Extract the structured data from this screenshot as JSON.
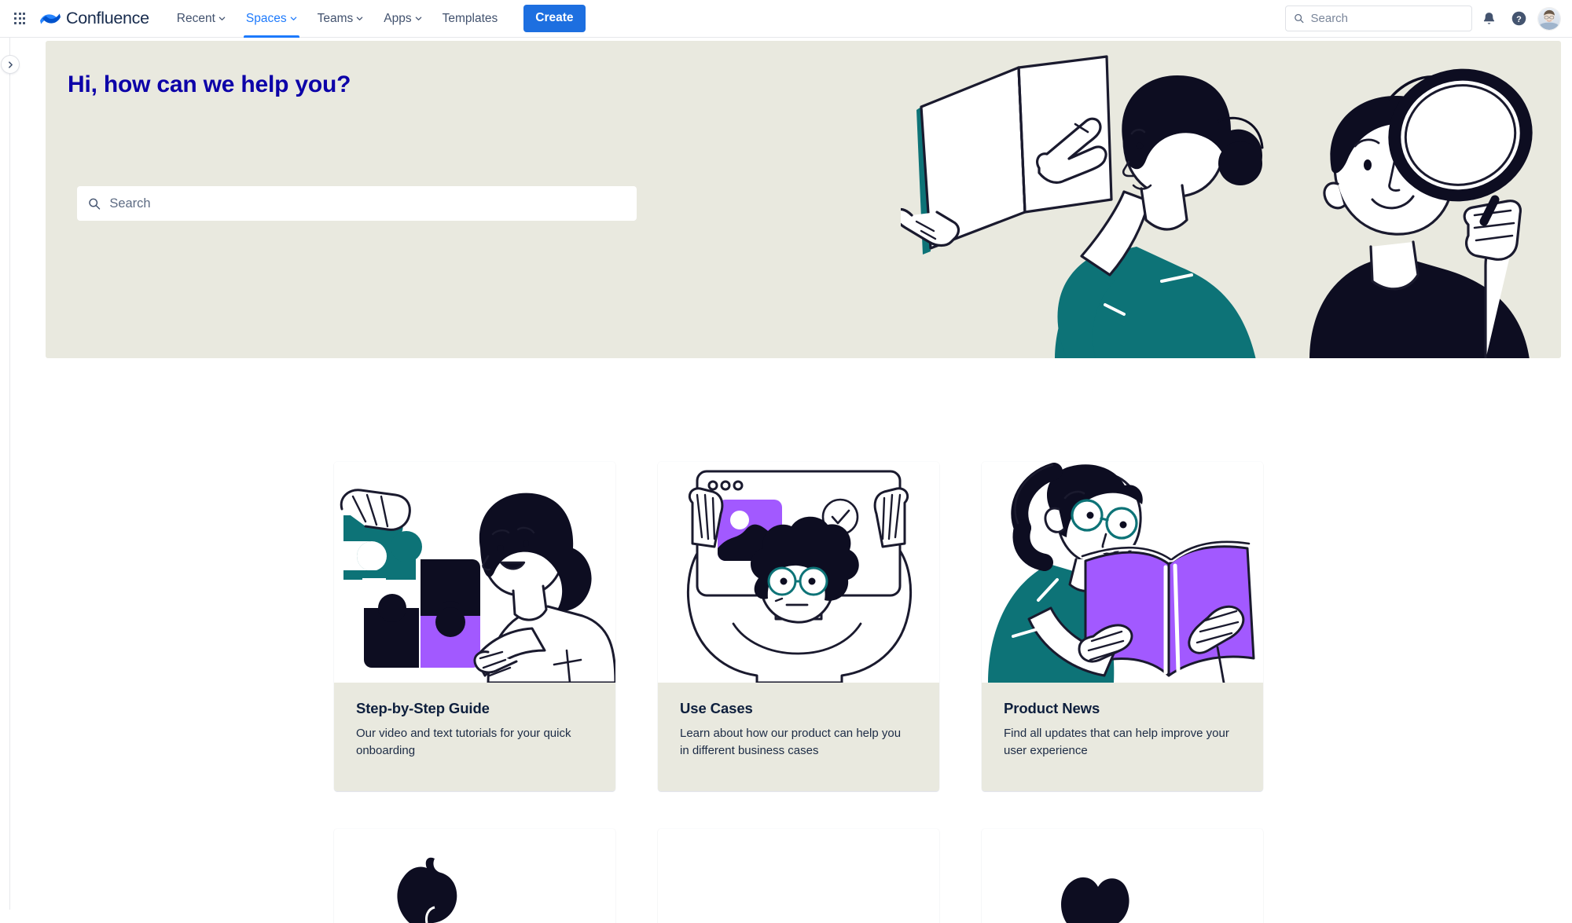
{
  "brand": {
    "name": "Confluence",
    "logo_icon": "confluence-logo-icon",
    "app_switcher_icon": "app-switcher-grid-icon"
  },
  "nav": {
    "items": [
      {
        "label": "Recent",
        "has_dropdown": true,
        "active": false
      },
      {
        "label": "Spaces",
        "has_dropdown": true,
        "active": true
      },
      {
        "label": "Teams",
        "has_dropdown": true,
        "active": false
      },
      {
        "label": "Apps",
        "has_dropdown": true,
        "active": false
      },
      {
        "label": "Templates",
        "has_dropdown": false,
        "active": false
      }
    ],
    "create_label": "Create",
    "search": {
      "placeholder": "Search",
      "value": "",
      "icon": "search-icon"
    },
    "notifications_icon": "notification-bell-icon",
    "help_icon": "help-circle-icon",
    "avatar_name": "user-avatar"
  },
  "sidebar": {
    "expand_icon": "chevron-right-icon",
    "expand_label": "Expand sidebar"
  },
  "hero": {
    "title": "Hi, how can we help you?",
    "search": {
      "placeholder": "Search",
      "value": "",
      "icon": "search-icon"
    },
    "background_color": "#e9e9df",
    "title_color": "#0c00a8",
    "illustration": "people-reading-and-searching-illustration"
  },
  "cards": [
    {
      "title": "Step-by-Step Guide",
      "description": "Our video and text tutorials for your quick onboarding",
      "illustration": "puzzle-pieces-woman-illustration"
    },
    {
      "title": "Use Cases",
      "description": "Learn about how our product can help you in different business cases",
      "illustration": "browser-window-person-illustration"
    },
    {
      "title": "Product News",
      "description": "Find all updates that can help improve your user experience",
      "illustration": "woman-reading-book-illustration"
    }
  ],
  "cards_row2": [
    {
      "illustration": "person-illustration-partial-1"
    },
    {
      "illustration": "person-illustration-partial-2"
    },
    {
      "illustration": "person-illustration-partial-3"
    }
  ],
  "colors": {
    "accent_blue": "#1d7afc",
    "create_button": "#1d6fe0",
    "beige": "#e9e9df",
    "teal": "#0d7377",
    "purple": "#a259ff",
    "ink": "#0d0d21"
  }
}
